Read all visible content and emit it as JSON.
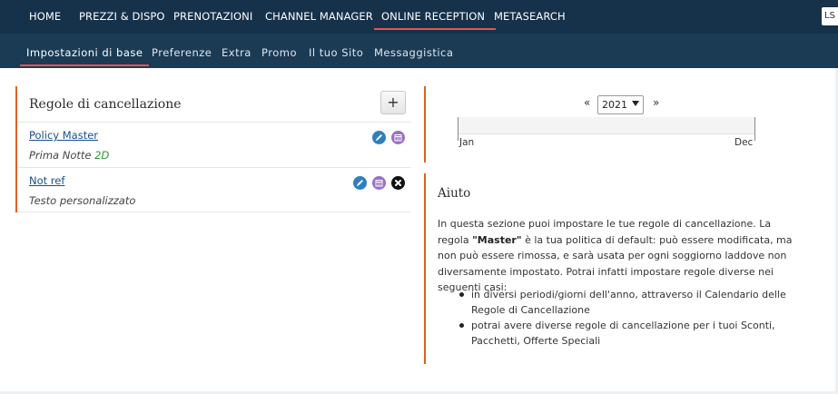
{
  "topnav": {
    "items": [
      {
        "label": "HOME"
      },
      {
        "label": "PREZZI & DISPO"
      },
      {
        "label": "PRENOTAZIONI"
      },
      {
        "label": "CHANNEL MANAGER"
      },
      {
        "label": "ONLINE RECEPTION",
        "active": true
      },
      {
        "label": "METASEARCH"
      }
    ],
    "user_initials": "LS"
  },
  "subnav": {
    "items": [
      {
        "label": "Impostazioni di base",
        "active": true
      },
      {
        "label": "Preferenze"
      },
      {
        "label": "Extra"
      },
      {
        "label": "Promo"
      },
      {
        "label": "Il tuo Sito"
      },
      {
        "label": "Messaggistica"
      }
    ]
  },
  "rules_panel": {
    "title": "Regole di cancellazione",
    "add_label": "+",
    "rules": [
      {
        "name": "Policy Master",
        "desc": "Prima Notte",
        "tag": "2D",
        "deletable": false
      },
      {
        "name": "Not ref",
        "desc": "Testo personalizzato",
        "tag": "",
        "deletable": true
      }
    ]
  },
  "calendar": {
    "prev": "«",
    "next": "»",
    "year": "2021",
    "start_label": "Jan",
    "end_label": "Dec"
  },
  "help": {
    "title": "Aiuto",
    "intro_before": "In questa sezione puoi impostare le tue regole di cancellazione. La regola ",
    "intro_bold": "\"Master\"",
    "intro_after": " è la tua politica di default: può essere modificata, ma non può essere rimossa, e sarà usata per ogni soggiorno laddove non diversamente impostato. Potrai infatti impostare regole diverse nei seguenti casi:",
    "bullets": [
      "in diversi periodi/giorni dell'anno, attraverso il Calendario delle Regole di Cancellazione",
      "potrai avere diverse regole di cancellazione per i tuoi Sconti, Pacchetti, Offerte Speciali"
    ]
  },
  "colors": {
    "topnav_bg": "#16324a",
    "subnav_bg": "#1b3b55",
    "accent": "#e0574f",
    "panel_border": "#d9622a",
    "link": "#1a4f8a",
    "tag_green": "#2a9a2a"
  }
}
